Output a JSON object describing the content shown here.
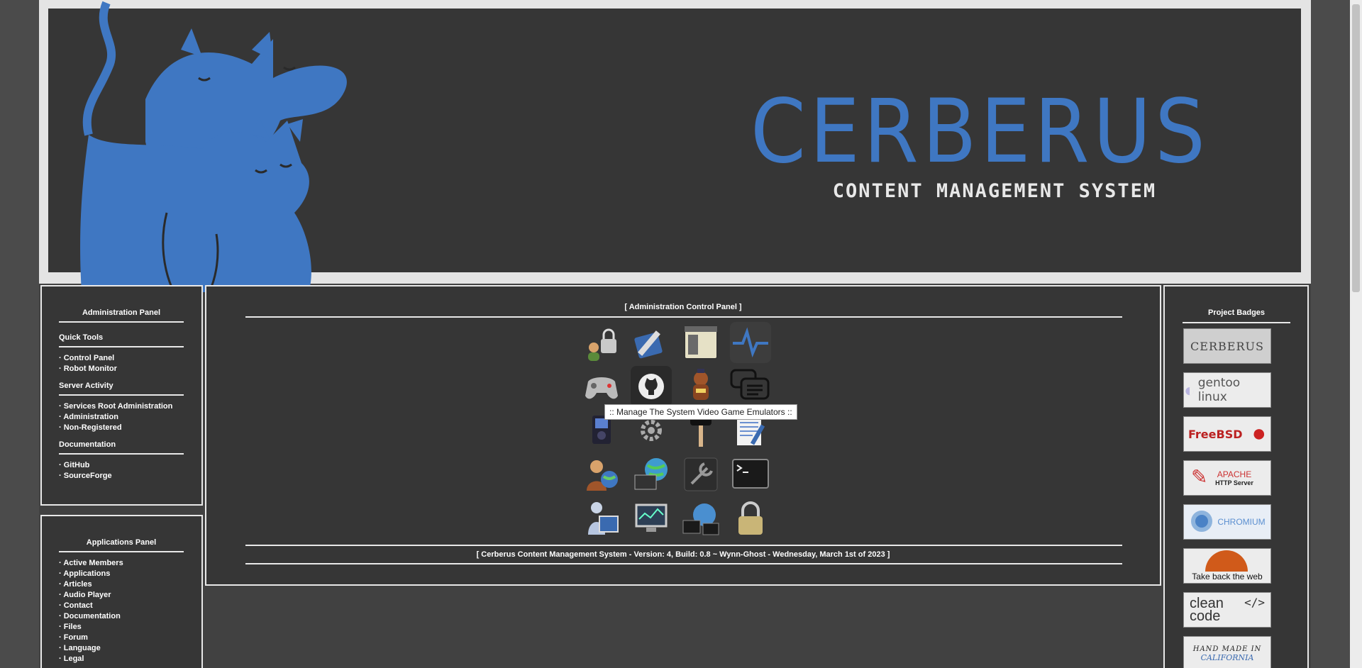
{
  "brand": {
    "title": "CERBERUS",
    "subtitle": "CONTENT MANAGEMENT SYSTEM"
  },
  "admin_panel": {
    "title": "Administration Panel",
    "sections": [
      {
        "heading": "Quick Tools",
        "items": [
          "Control Panel",
          "Robot Monitor"
        ]
      },
      {
        "heading": "Server Activity",
        "items": [
          "Services Root Administration",
          "Administration",
          "Non-Registered"
        ]
      },
      {
        "heading": "Documentation",
        "items": [
          "GitHub",
          "SourceForge"
        ]
      }
    ]
  },
  "apps_panel": {
    "title": "Applications Panel",
    "items": [
      "Active Members",
      "Applications",
      "Articles",
      "Audio Player",
      "Contact",
      "Documentation",
      "Files",
      "Forum",
      "Language",
      "Legal"
    ]
  },
  "control_panel": {
    "title": "[ Administration Control Panel ]",
    "footer": "[ Cerberus Content Management System - Version: 4, Build: 0.8 ~ Wynn-Ghost - Wednesday, March 1st of 2023 ]",
    "tooltip": ":: Manage The System Video Game Emulators ::",
    "icons": [
      "users-lock-icon",
      "edit-pen-icon",
      "window-panel-icon",
      "activity-monitor-icon",
      "gamepad-icon",
      "github-icon",
      "robot-mascot-icon",
      "chat-bubbles-icon",
      "media-player-icon",
      "gear-icon",
      "microphone-icon",
      "notepad-icon",
      "user-globe-icon",
      "network-globe-icon",
      "wrench-icon",
      "terminal-icon",
      "user-desktop-icon",
      "monitor-icon",
      "network-computers-icon",
      "padlock-icon"
    ]
  },
  "badges": {
    "title": "Project Badges",
    "items": [
      {
        "name": "cerberus-badge",
        "text": "CERBERUS"
      },
      {
        "name": "gentoo-badge",
        "text": "gentoo linux"
      },
      {
        "name": "freebsd-badge",
        "text": "FreeBSD"
      },
      {
        "name": "apache-badge",
        "text": "APACHE",
        "subtext": "HTTP Server"
      },
      {
        "name": "chromium-badge",
        "text": "CHROMIUM"
      },
      {
        "name": "firefox-badge",
        "text": "Take back the web"
      },
      {
        "name": "cleancode-badge",
        "text": "clean",
        "subtext": "code"
      },
      {
        "name": "handmade-badge",
        "text": "HAND MADE IN",
        "subtext": "CALIFORNIA"
      }
    ]
  },
  "colors": {
    "brand_blue": "#3f77c2",
    "panel_bg": "#363636",
    "page_bg": "#414141",
    "border": "#e8e8e8"
  }
}
